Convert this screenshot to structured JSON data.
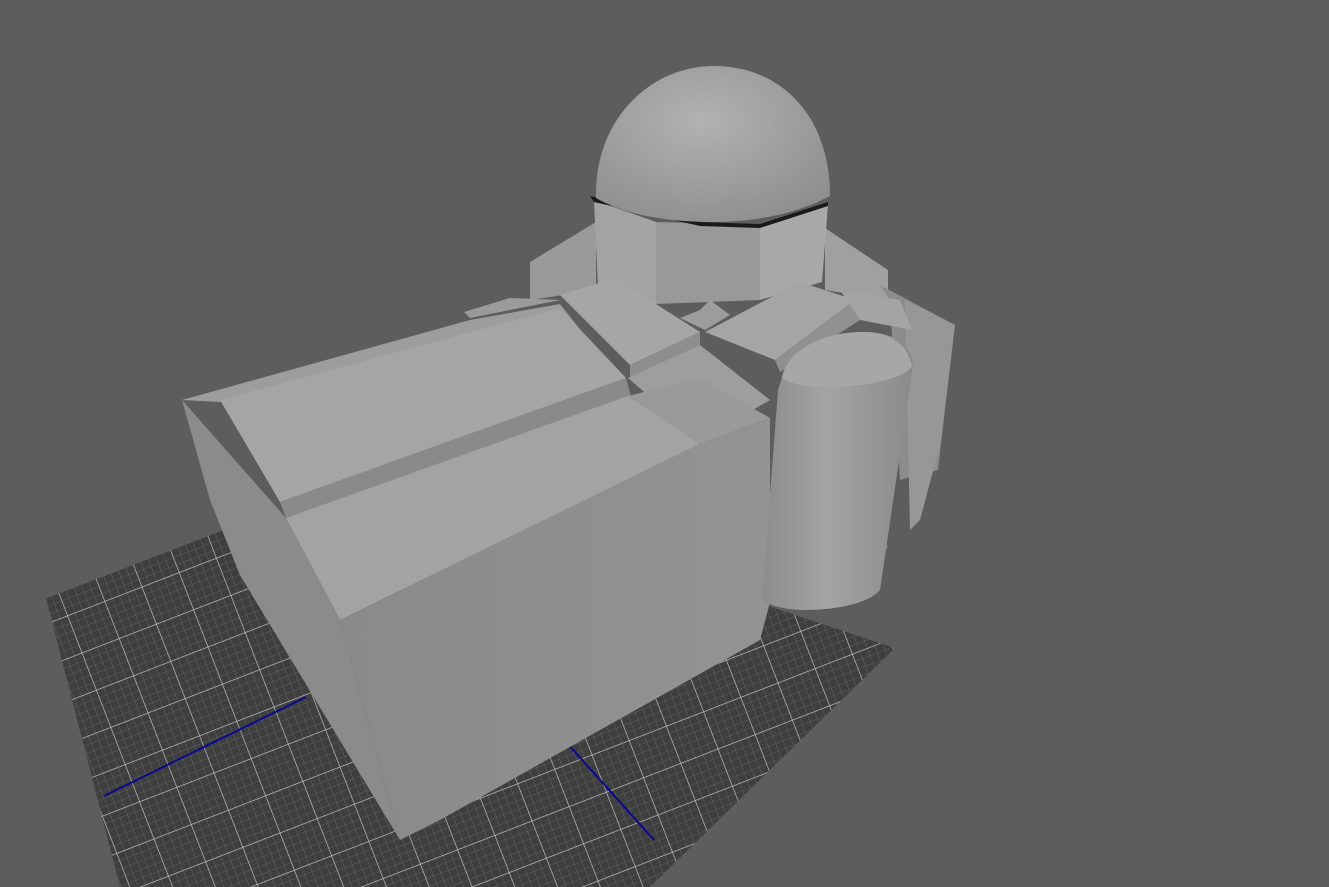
{
  "viewport": {
    "kind": "3d-modeling-viewport",
    "shading": "smooth-shaded-gray"
  },
  "colors": {
    "background": "#5d5d5d",
    "grid_fill": "#3e3e3e",
    "grid_line": "#9a9a9a",
    "grid_major": "#c8c8c8",
    "axis_line": "#0b0b8f",
    "model_light": "#a8a8a8",
    "model_mid": "#949494",
    "model_dark": "#7e7e7e"
  },
  "scene_objects": [
    "ground-grid",
    "main-building-block",
    "dome",
    "drum-tower",
    "side-cylinder",
    "cross-roof"
  ]
}
